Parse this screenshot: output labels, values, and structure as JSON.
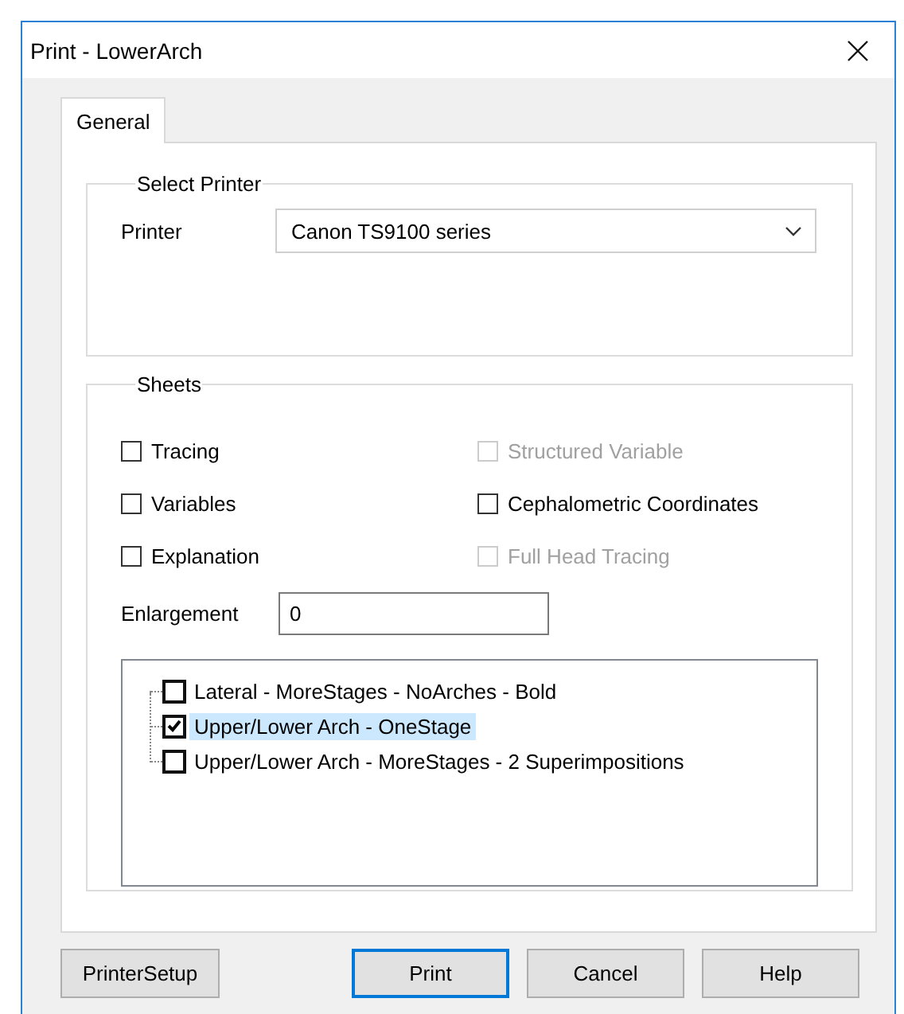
{
  "window": {
    "title": "Print - LowerArch"
  },
  "tabs": [
    {
      "label": "General",
      "selected": true
    }
  ],
  "select_printer": {
    "title": "Select Printer",
    "label": "Printer",
    "value": "Canon TS9100 series"
  },
  "sheets": {
    "title": "Sheets",
    "options": [
      {
        "label": "Tracing",
        "checked": false,
        "disabled": false
      },
      {
        "label": "Structured Variable",
        "checked": false,
        "disabled": true
      },
      {
        "label": "Variables",
        "checked": false,
        "disabled": false
      },
      {
        "label": "Cephalometric Coordinates",
        "checked": false,
        "disabled": false
      },
      {
        "label": "Explanation",
        "checked": false,
        "disabled": false
      },
      {
        "label": "Full Head Tracing",
        "checked": false,
        "disabled": true
      }
    ],
    "enlargement": {
      "label": "Enlargement",
      "value": "0"
    },
    "tree": [
      {
        "label": "Lateral - MoreStages - NoArches - Bold",
        "checked": false,
        "selected": false
      },
      {
        "label": "Upper/Lower Arch - OneStage",
        "checked": true,
        "selected": true
      },
      {
        "label": "Upper/Lower Arch - MoreStages - 2 Superimpositions",
        "checked": false,
        "selected": false
      }
    ]
  },
  "buttons": [
    {
      "label": "PrinterSetup",
      "default": false
    },
    {
      "label": "Print",
      "default": true
    },
    {
      "label": "Cancel",
      "default": false
    },
    {
      "label": "Help",
      "default": false
    }
  ]
}
